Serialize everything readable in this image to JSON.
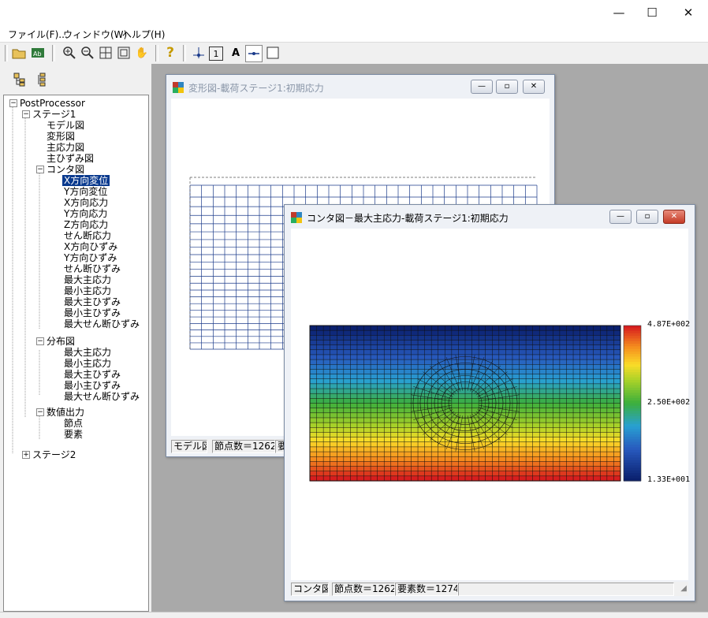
{
  "menu": {
    "file": "ファイル(F)...",
    "window": "ウィンドウ(W)",
    "help": "ヘルプ(H)"
  },
  "tree": {
    "root": "PostProcessor",
    "stage1": "ステージ1",
    "model": "モデル図",
    "deform": "変形図",
    "principal_stress": "主応力図",
    "principal_strain": "主ひずみ図",
    "contour": "コンタ図",
    "contour_items": [
      "X方向変位",
      "Y方向変位",
      "X方向応力",
      "Y方向応力",
      "Z方向応力",
      "せん断応力",
      "X方向ひずみ",
      "Y方向ひずみ",
      "せん断ひずみ",
      "最大主応力",
      "最小主応力",
      "最大主ひずみ",
      "最小主ひずみ",
      "最大せん断ひずみ"
    ],
    "selected_index": 0,
    "distribution": "分布図",
    "distribution_items": [
      "最大主応力",
      "最小主応力",
      "最大主ひずみ",
      "最小主ひずみ",
      "最大せん断ひずみ"
    ],
    "numeric": "数値出力",
    "numeric_items": [
      "節点",
      "要素"
    ],
    "stage2": "ステージ2"
  },
  "win_deform": {
    "title": "変形図-載荷ステージ1:初期応力",
    "status": [
      "モデル図",
      "節点数＝1262",
      "要"
    ]
  },
  "win_contour": {
    "title": "コンタ図－最大主応力-載荷ステージ1:初期応力",
    "status": [
      "コンタ図",
      "節点数＝1262",
      "要素数＝1274"
    ],
    "legend": {
      "max": "4.87E+002",
      "mid": "2.50E+002",
      "min": "1.33E+001"
    }
  },
  "colors": {
    "accent": "#0a3a8e",
    "mesh": "#1a3a8a"
  }
}
